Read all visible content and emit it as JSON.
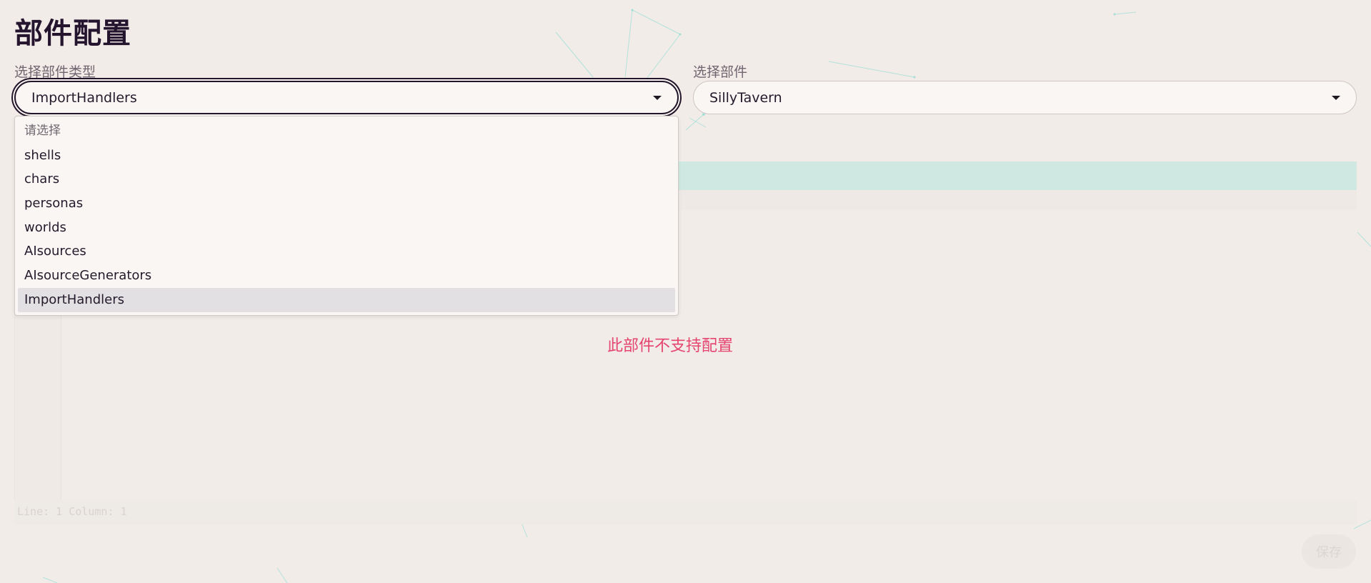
{
  "page": {
    "title": "部件配置"
  },
  "part_type": {
    "label": "选择部件类型",
    "value": "ImportHandlers",
    "options": [
      {
        "label": "请选择"
      },
      {
        "label": "shells"
      },
      {
        "label": "chars"
      },
      {
        "label": "personas"
      },
      {
        "label": "worlds"
      },
      {
        "label": "AIsources"
      },
      {
        "label": "AIsourceGenerators"
      },
      {
        "label": "ImportHandlers"
      }
    ]
  },
  "part": {
    "label": "选择部件",
    "value": "SillyTavern"
  },
  "editor": {
    "notice": "此部件不支持配置",
    "status": "Line: 1  Column: 1"
  },
  "actions": {
    "save_label": "保存"
  },
  "colors": {
    "accent_teal": "#cfe9e2",
    "notice_pink": "#e5446e",
    "title_dark": "#24142e"
  }
}
